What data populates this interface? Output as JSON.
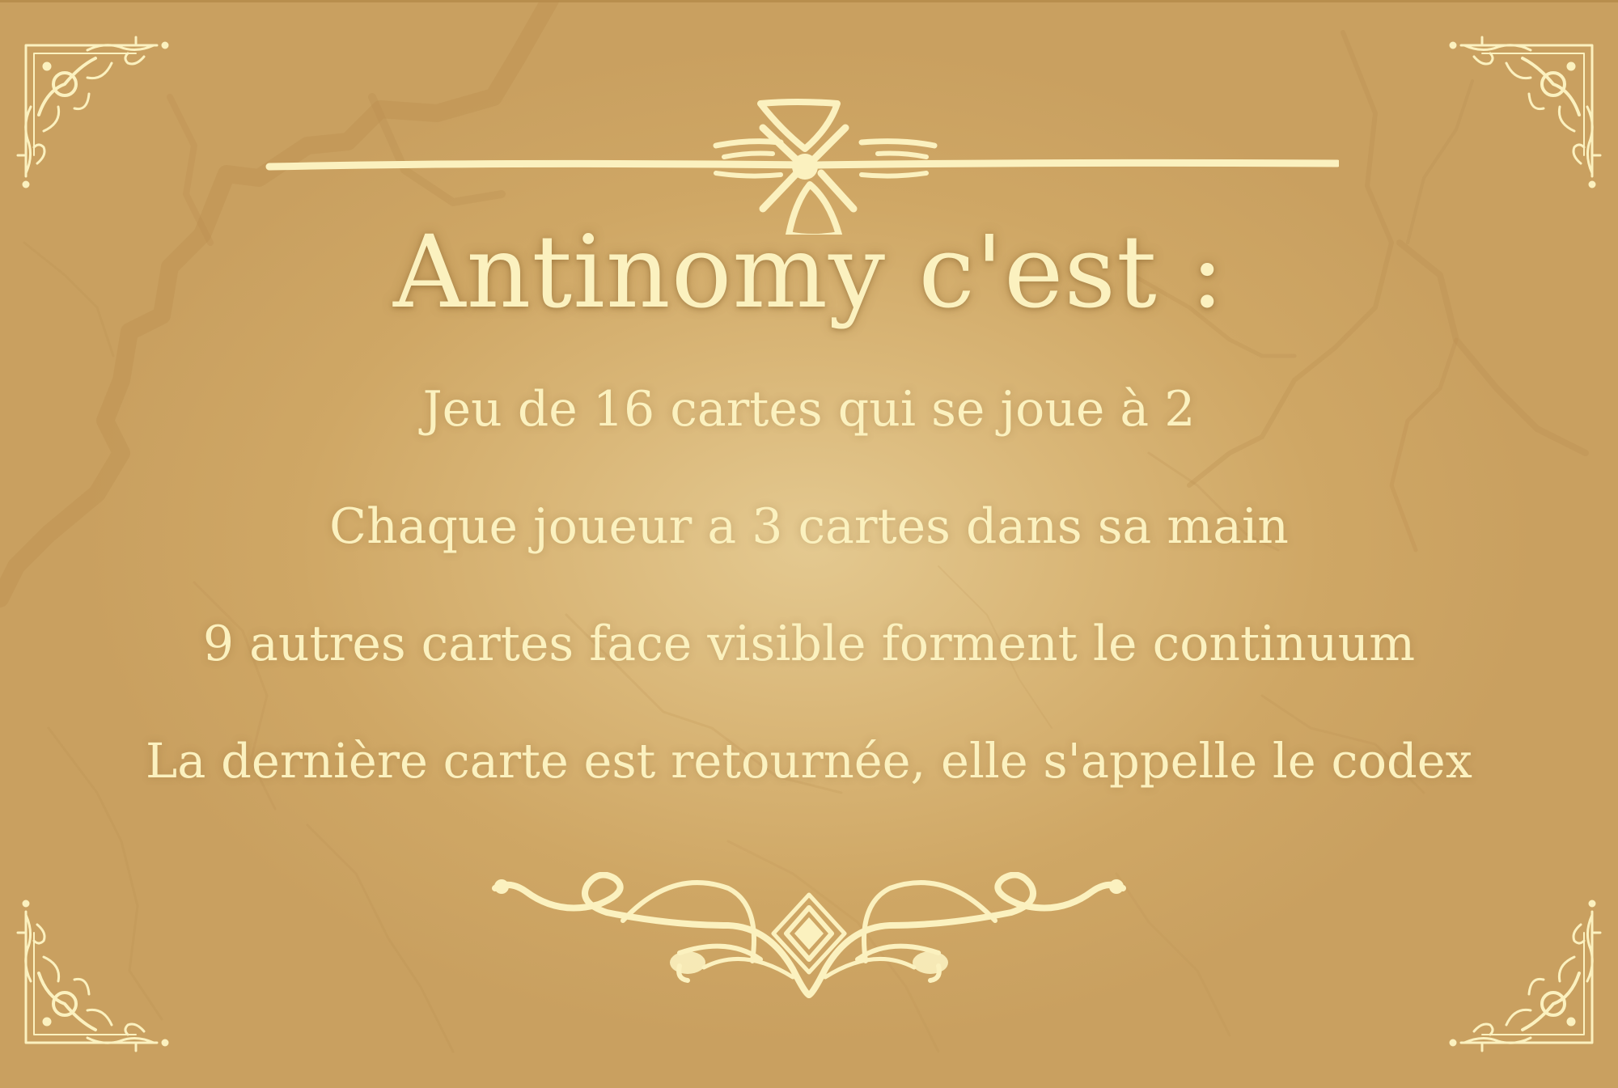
{
  "slide": {
    "title": "Antinomy c'est :",
    "lines": [
      "Jeu de 16 cartes qui se joue à 2",
      "Chaque joueur a 3 cartes dans sa main",
      "9 autres cartes face visible forment le continuum",
      "La dernière carte est retournée, elle s'appelle le codex"
    ]
  },
  "colors": {
    "background": "#d4ad6a",
    "ornament": "#fbf1bf",
    "text": "#fbf1bf",
    "veins": "#b98d4e"
  },
  "icons": {
    "top_divider": "flourish-divider-icon",
    "bottom_divider": "scroll-flourish-icon",
    "corners": "corner-flourish-icon"
  }
}
